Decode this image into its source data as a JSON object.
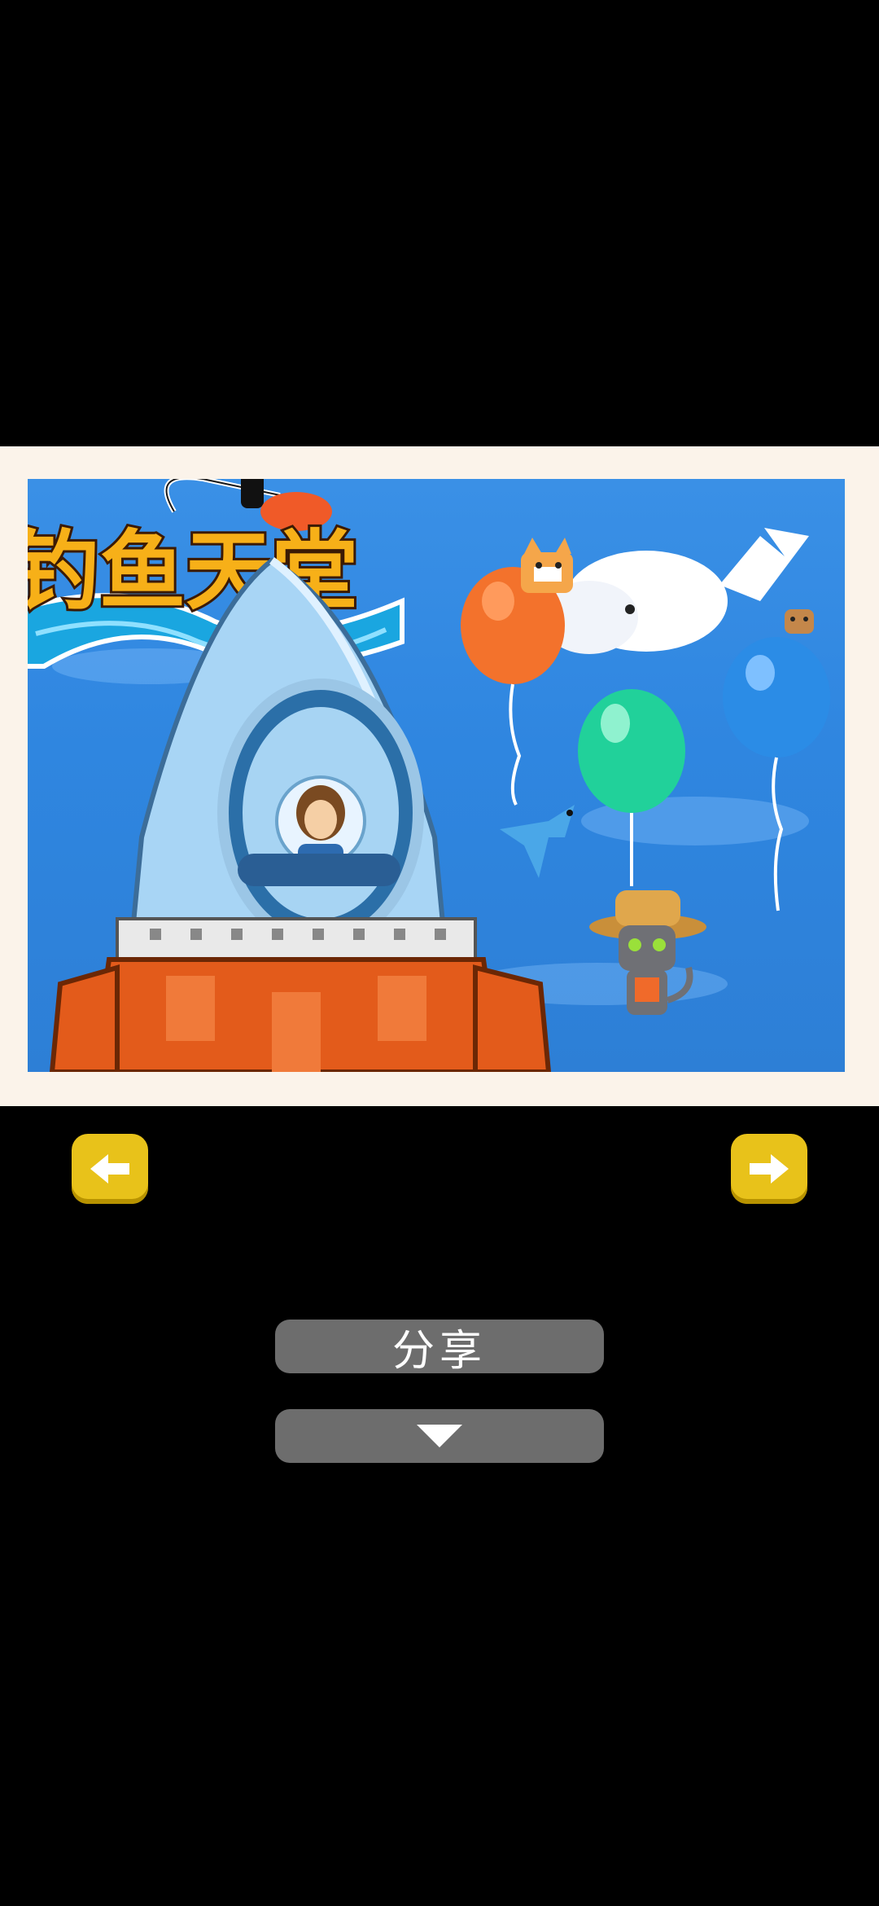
{
  "game": {
    "logo_text": "钓鱼天堂"
  },
  "controls": {
    "prev_icon": "arrow-left-icon",
    "next_icon": "arrow-right-icon",
    "share_label": "分享",
    "collapse_icon": "triangle-down-icon"
  },
  "colors": {
    "background": "#000000",
    "frame": "#fbf3ea",
    "sky": "#3a90e6",
    "nav_button": "#e8c21a",
    "pill_button": "#6d6d6d"
  }
}
